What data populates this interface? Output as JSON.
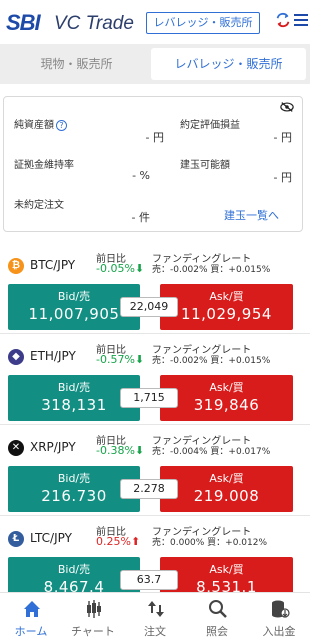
{
  "header": {
    "logo_sbi": "SBI",
    "logo_vc": "VC Trade",
    "mode_button": "レバレッジ・販売所"
  },
  "tabs": [
    {
      "label": "現物・販売所",
      "active": false
    },
    {
      "label": "レバレッジ・販売所",
      "active": true
    }
  ],
  "summary": {
    "net_assets_label": "純資産額",
    "net_assets_value": "- 円",
    "unrealized_pl_label": "約定評価損益",
    "unrealized_pl_value": "- 円",
    "margin_rate_label": "証拠金維持率",
    "margin_rate_value": "- %",
    "available_label": "建玉可能額",
    "available_value": "- 円",
    "open_orders_label": "未約定注文",
    "open_orders_value": "- 件",
    "positions_link": "建玉一覧へ"
  },
  "markets": [
    {
      "pair": "BTC/JPY",
      "icon": "btc-icon",
      "icon_color": "#f7931a",
      "prev_label": "前日比",
      "change": "-0.05%",
      "direction": "down",
      "funding_label": "ファンディングレート",
      "funding": "売：-0.002% 買：+0.015%",
      "bid_label": "Bid/売",
      "bid": "11,007,905",
      "ask_label": "Ask/買",
      "ask": "11,029,954",
      "spread": "22,049"
    },
    {
      "pair": "ETH/JPY",
      "icon": "eth-icon",
      "icon_color": "#3c3c8a",
      "prev_label": "前日比",
      "change": "-0.57%",
      "direction": "down",
      "funding_label": "ファンディングレート",
      "funding": "売：-0.002% 買：+0.015%",
      "bid_label": "Bid/売",
      "bid": "318,131",
      "ask_label": "Ask/買",
      "ask": "319,846",
      "spread": "1,715"
    },
    {
      "pair": "XRP/JPY",
      "icon": "xrp-icon",
      "icon_color": "#111111",
      "prev_label": "前日比",
      "change": "-0.38%",
      "direction": "down",
      "funding_label": "ファンディングレート",
      "funding": "売：-0.004% 買：+0.017%",
      "bid_label": "Bid/売",
      "bid": "216.730",
      "ask_label": "Ask/買",
      "ask": "219.008",
      "spread": "2.278"
    },
    {
      "pair": "LTC/JPY",
      "icon": "ltc-icon",
      "icon_color": "#345d9d",
      "prev_label": "前日比",
      "change": "0.25%",
      "direction": "up",
      "funding_label": "ファンディングレート",
      "funding": "売：0.000% 買：+0.012%",
      "bid_label": "Bid/売",
      "bid": "8,467.4",
      "ask_label": "Ask/買",
      "ask": "8,531.1",
      "spread": "63.7"
    }
  ],
  "nav": [
    {
      "label": "ホーム",
      "icon": "home-icon",
      "active": true
    },
    {
      "label": "チャート",
      "icon": "chart-icon",
      "active": false
    },
    {
      "label": "注文",
      "icon": "order-icon",
      "active": false
    },
    {
      "label": "照会",
      "icon": "inquiry-icon",
      "active": false
    },
    {
      "label": "入出金",
      "icon": "deposit-icon",
      "active": false
    }
  ],
  "colors": {
    "accent": "#2f6fd6",
    "bid": "#128f82",
    "ask": "#d81b1b",
    "down": "#16a34a",
    "up": "#dc2626"
  }
}
